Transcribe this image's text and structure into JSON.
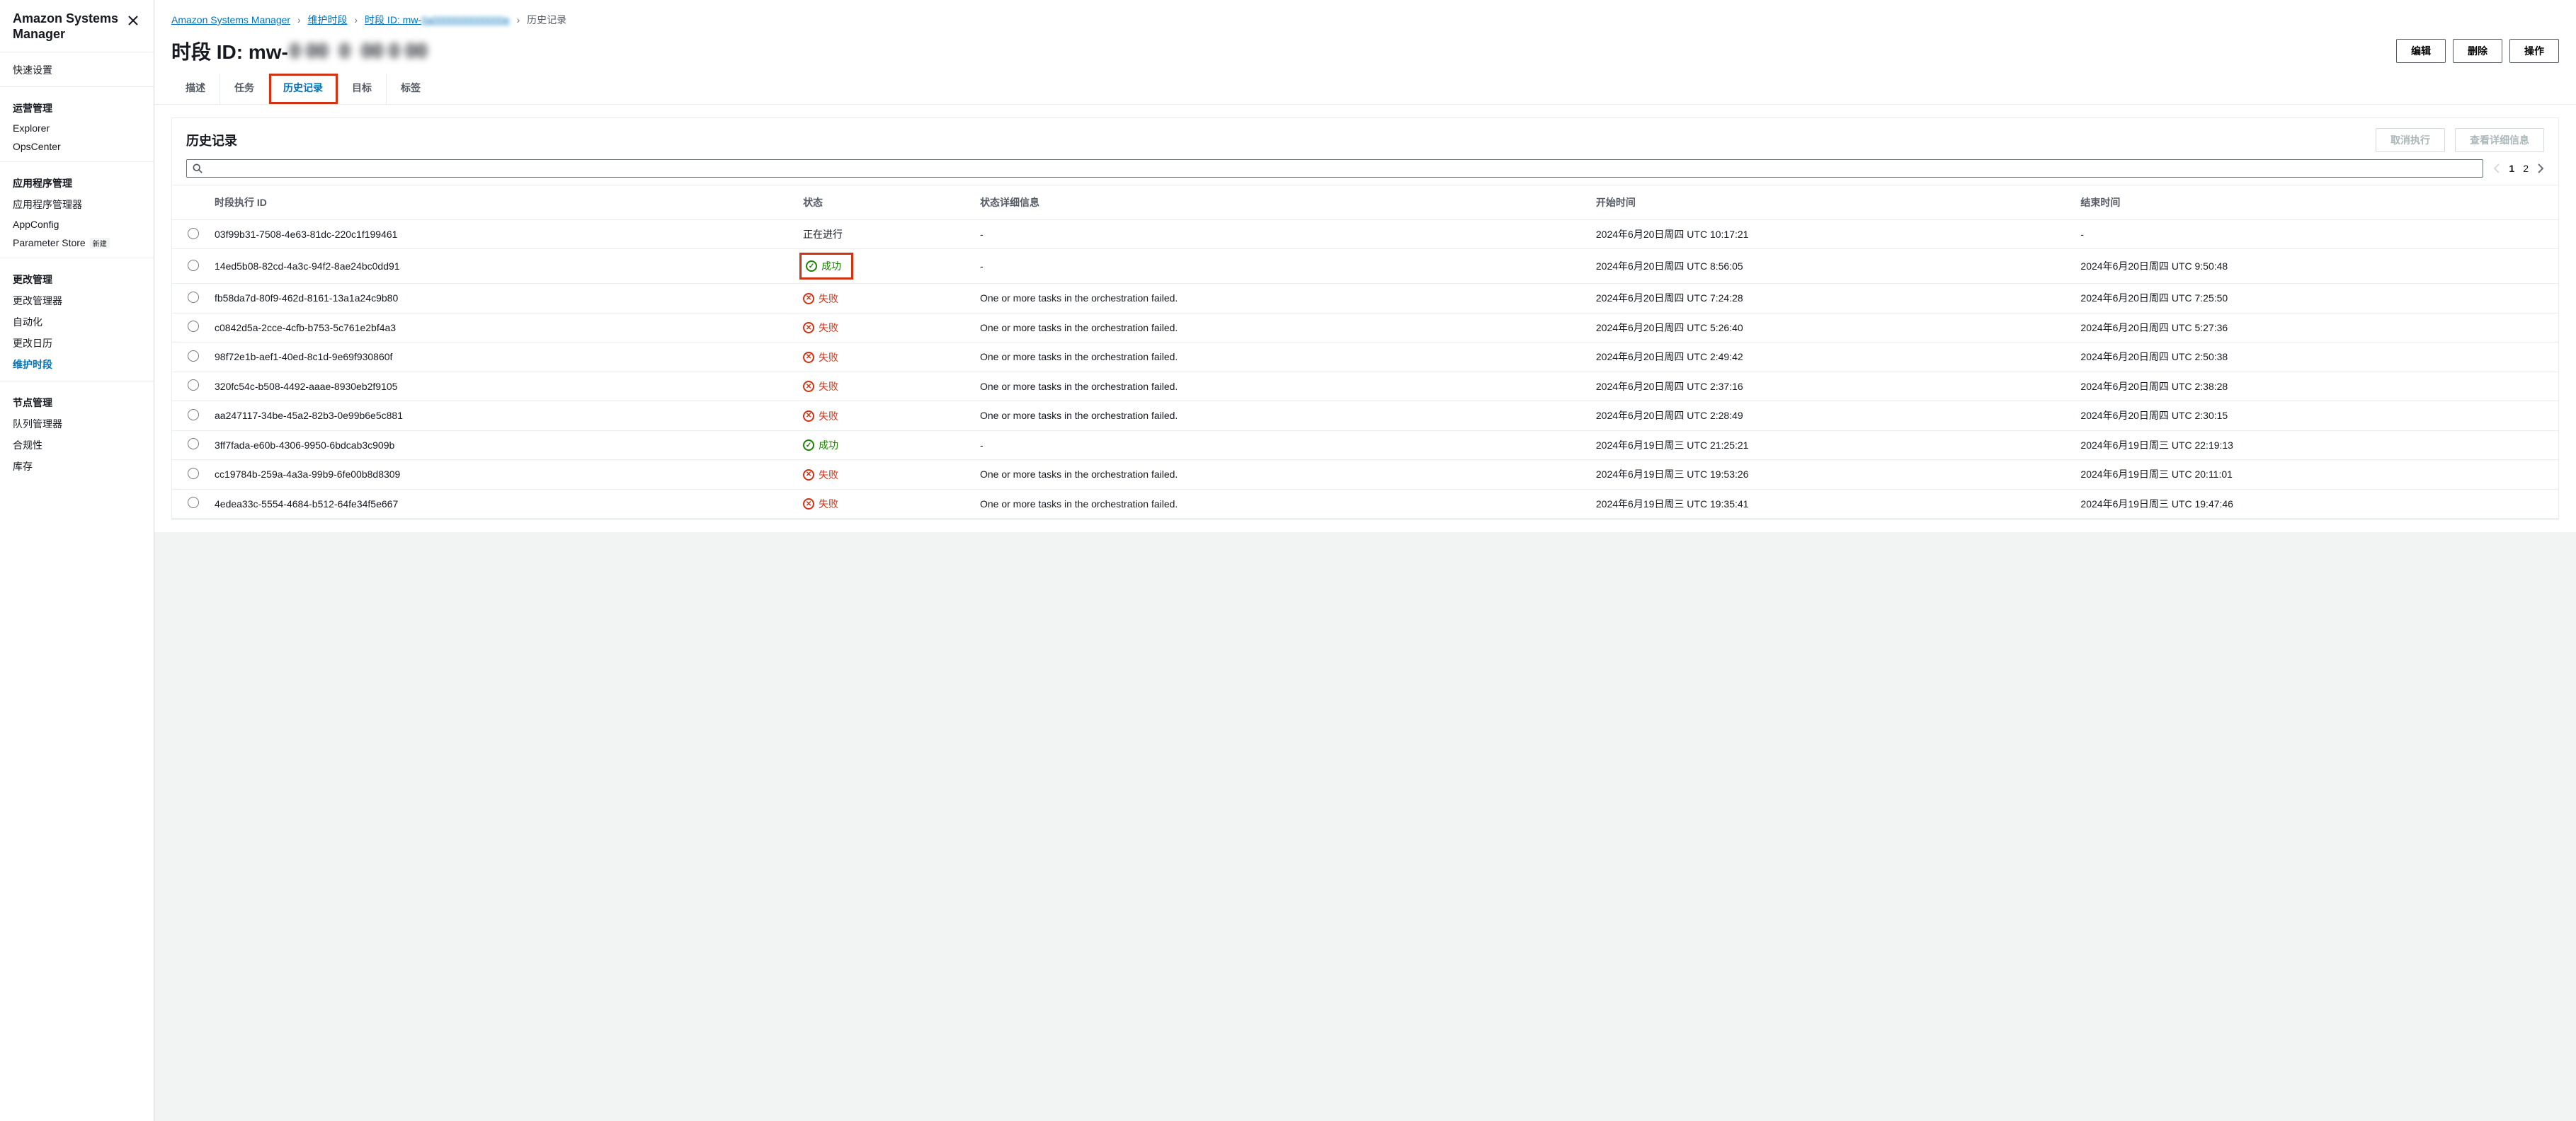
{
  "sidebar": {
    "title": "Amazon Systems Manager",
    "quick": "快速设置",
    "groups": [
      {
        "label": "运营管理",
        "items": [
          "Explorer",
          "OpsCenter"
        ]
      },
      {
        "label": "应用程序管理",
        "items": [
          "应用程序管理器",
          "AppConfig"
        ],
        "badge_item": "Parameter Store",
        "badge": "新建"
      },
      {
        "label": "更改管理",
        "items": [
          "更改管理器",
          "自动化",
          "更改日历"
        ],
        "active": "维护时段"
      },
      {
        "label": "节点管理",
        "items": [
          "队列管理器",
          "合规性",
          "库存"
        ]
      }
    ]
  },
  "breadcrumbs": {
    "root": "Amazon Systems Manager",
    "l1": "维护时段",
    "l2_prefix": "时段 ID: mw-",
    "current": "历史记录"
  },
  "page": {
    "title_prefix": "时段 ID: mw-",
    "edit": "编辑",
    "delete": "删除",
    "actions": "操作"
  },
  "tabs": {
    "desc": "描述",
    "task": "任务",
    "history": "历史记录",
    "target": "目标",
    "tag": "标签"
  },
  "card": {
    "title": "历史记录",
    "cancel": "取消执行",
    "detail": "查看详细信息",
    "page1": "1",
    "page2": "2"
  },
  "table": {
    "headers": {
      "id": "时段执行 ID",
      "status": "状态",
      "detail": "状态详细信息",
      "start": "开始时间",
      "end": "结束时间"
    },
    "statuses": {
      "progress": "正在进行",
      "success": "成功",
      "fail": "失败",
      "fail_detail": "One or more tasks in the orchestration failed."
    },
    "rows": [
      {
        "id": "03f99b31-7508-4e63-81dc-220c1f199461",
        "status": "progress",
        "detail": "-",
        "start": "2024年6月20日周四 UTC 10:17:21",
        "end": "-"
      },
      {
        "id": "14ed5b08-82cd-4a3c-94f2-8ae24bc0dd91",
        "status": "success",
        "detail": "-",
        "start": "2024年6月20日周四 UTC 8:56:05",
        "end": "2024年6月20日周四 UTC 9:50:48",
        "highlight": true
      },
      {
        "id": "fb58da7d-80f9-462d-8161-13a1a24c9b80",
        "status": "fail",
        "detail": "fail",
        "start": "2024年6月20日周四 UTC 7:24:28",
        "end": "2024年6月20日周四 UTC 7:25:50"
      },
      {
        "id": "c0842d5a-2cce-4cfb-b753-5c761e2bf4a3",
        "status": "fail",
        "detail": "fail",
        "start": "2024年6月20日周四 UTC 5:26:40",
        "end": "2024年6月20日周四 UTC 5:27:36"
      },
      {
        "id": "98f72e1b-aef1-40ed-8c1d-9e69f930860f",
        "status": "fail",
        "detail": "fail",
        "start": "2024年6月20日周四 UTC 2:49:42",
        "end": "2024年6月20日周四 UTC 2:50:38"
      },
      {
        "id": "320fc54c-b508-4492-aaae-8930eb2f9105",
        "status": "fail",
        "detail": "fail",
        "start": "2024年6月20日周四 UTC 2:37:16",
        "end": "2024年6月20日周四 UTC 2:38:28"
      },
      {
        "id": "aa247117-34be-45a2-82b3-0e99b6e5c881",
        "status": "fail",
        "detail": "fail",
        "start": "2024年6月20日周四 UTC 2:28:49",
        "end": "2024年6月20日周四 UTC 2:30:15"
      },
      {
        "id": "3ff7fada-e60b-4306-9950-6bdcab3c909b",
        "status": "success",
        "detail": "-",
        "start": "2024年6月19日周三 UTC 21:25:21",
        "end": "2024年6月19日周三 UTC 22:19:13"
      },
      {
        "id": "cc19784b-259a-4a3a-99b9-6fe00b8d8309",
        "status": "fail",
        "detail": "fail",
        "start": "2024年6月19日周三 UTC 19:53:26",
        "end": "2024年6月19日周三 UTC 20:11:01"
      },
      {
        "id": "4edea33c-5554-4684-b512-64fe34f5e667",
        "status": "fail",
        "detail": "fail",
        "start": "2024年6月19日周三 UTC 19:35:41",
        "end": "2024年6月19日周三 UTC 19:47:46"
      }
    ]
  }
}
